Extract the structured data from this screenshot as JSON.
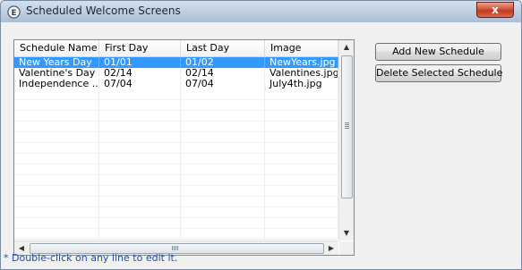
{
  "window": {
    "title": "Scheduled Welcome Screens",
    "close_label": "x",
    "app_icon": "app-logo-icon"
  },
  "list": {
    "columns": [
      "Schedule Name",
      "First Day",
      "Last Day",
      "Image"
    ],
    "rows": [
      {
        "name": "New Years Day",
        "first": "01/01",
        "last": "01/02",
        "image": "NewYears.jpg",
        "selected": true
      },
      {
        "name": "Valentine's Day",
        "first": "02/14",
        "last": "02/14",
        "image": "Valentines.jpg",
        "selected": false
      },
      {
        "name": "Independence ...",
        "first": "07/04",
        "last": "07/04",
        "image": "July4th.jpg",
        "selected": false
      }
    ],
    "selection_color": "#3399ff"
  },
  "buttons": {
    "add": "Add New Schedule",
    "delete": "Delete Selected Schedule"
  },
  "hint": "* Double-click on any line to edit it.",
  "scroll": {
    "up": "▲",
    "down": "▼",
    "left": "◀",
    "right": "▶"
  }
}
